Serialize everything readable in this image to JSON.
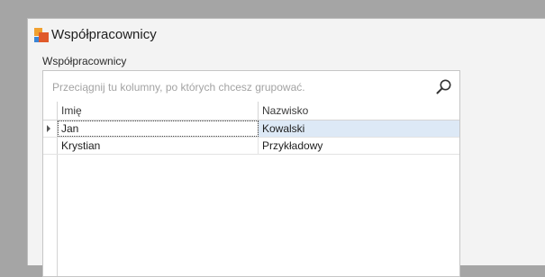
{
  "window": {
    "title": "Współpracownicy"
  },
  "group": {
    "label": "Współpracownicy"
  },
  "grid": {
    "group_panel_hint": "Przeciągnij tu kolumny, po których chcesz grupować.",
    "columns": [
      "Imię",
      "Nazwisko"
    ],
    "rows": [
      {
        "imie": "Jan",
        "nazwisko": "Kowalski",
        "focused": true
      },
      {
        "imie": "Krystian",
        "nazwisko": "Przykładowy",
        "focused": false
      }
    ]
  },
  "icons": {
    "app": "app-logo-icon",
    "search": "search-icon",
    "row_indicator": "row-indicator-arrow-icon"
  },
  "colors": {
    "focused_row": "#dde9f6",
    "background": "#a5a5a5"
  }
}
